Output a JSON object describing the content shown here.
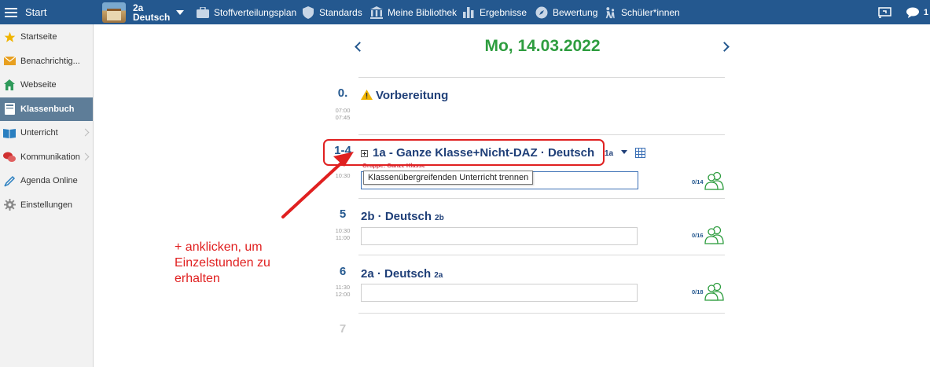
{
  "topbar": {
    "start_label": "Start",
    "class_name": "2a",
    "class_subject": "Deutsch",
    "nav": [
      {
        "label": "Stoffverteilungsplan",
        "icon": "briefcase-icon"
      },
      {
        "label": "Standards",
        "icon": "shield-icon"
      },
      {
        "label": "Meine Bibliothek",
        "icon": "library-icon"
      },
      {
        "label": "Ergebnisse",
        "icon": "bar-chart-icon"
      },
      {
        "label": "Bewertung",
        "icon": "compass-icon"
      },
      {
        "label": "Schüler*innen",
        "icon": "students-icon"
      }
    ],
    "chat_count": "1"
  },
  "sidebar": {
    "items": [
      {
        "label": "Startseite",
        "icon": "star-icon",
        "color": "#f0b400"
      },
      {
        "label": "Benachrichtig...",
        "icon": "envelope-icon",
        "color": "#e8a020"
      },
      {
        "label": "Webseite",
        "icon": "home-icon",
        "color": "#2f9a5a"
      },
      {
        "label": "Klassenbuch",
        "icon": "book-icon",
        "color": "#ffffff"
      },
      {
        "label": "Unterricht",
        "icon": "open-book-icon",
        "color": "#2a7fc0"
      },
      {
        "label": "Kommunikation",
        "icon": "chat-bubbles-icon",
        "color": "#d03030"
      },
      {
        "label": "Agenda Online",
        "icon": "pen-icon",
        "color": "#2a7fc0"
      },
      {
        "label": "Einstellungen",
        "icon": "gear-icon",
        "color": "#888888"
      }
    ]
  },
  "main": {
    "date": "Mo, 14.03.2022",
    "periods": [
      {
        "num": "0.",
        "start": "07:00",
        "end": "07:45",
        "title": "Vorbereitung"
      },
      {
        "num": "1-4",
        "start": "",
        "end": "10:30",
        "title": "1a - Ganze Klasse+Nicht-DAZ · Deutsch",
        "title_cut_sub": "1a",
        "group": "Gruppe: Ganze Klasse",
        "tooltip": "Klassenübergreifenden Unterricht trennen",
        "count": "0/14"
      },
      {
        "num": "5",
        "start": "10:30",
        "end": "11:00",
        "title": "2b · Deutsch",
        "sub": "2b",
        "count": "0/16"
      },
      {
        "num": "6",
        "start": "11:30",
        "end": "12:00",
        "title": "2a · Deutsch",
        "sub": "2a",
        "count": "0/18"
      },
      {
        "num": "7"
      }
    ],
    "annotation": "+ anklicken, um Einzelstunden zu erhalten"
  }
}
